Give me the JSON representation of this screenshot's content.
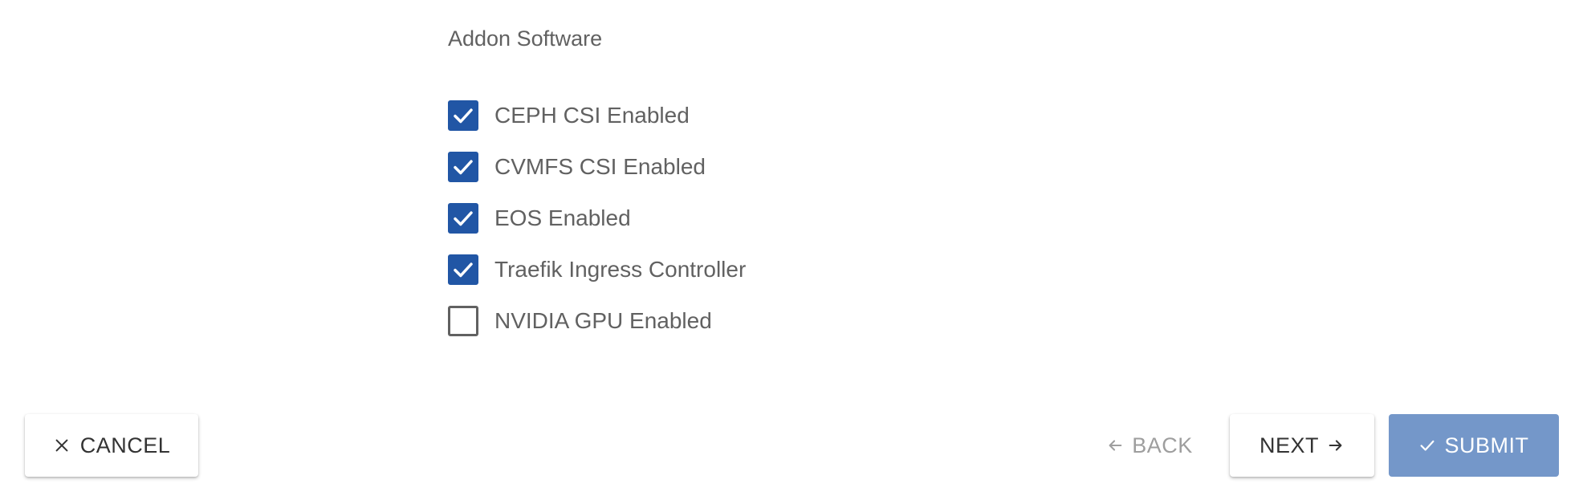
{
  "section": {
    "title": "Addon Software"
  },
  "options": [
    {
      "label": "CEPH CSI Enabled",
      "checked": true
    },
    {
      "label": "CVMFS CSI Enabled",
      "checked": true
    },
    {
      "label": "EOS Enabled",
      "checked": true
    },
    {
      "label": "Traefik Ingress Controller",
      "checked": true
    },
    {
      "label": "NVIDIA GPU Enabled",
      "checked": false
    }
  ],
  "actions": {
    "cancel_label": "CANCEL",
    "back_label": "BACK",
    "next_label": "NEXT",
    "submit_label": "SUBMIT"
  },
  "icons": {
    "cancel": "close-icon",
    "back": "arrow-left-icon",
    "next": "arrow-right-icon",
    "submit": "check-icon",
    "checkbox": "check-icon"
  },
  "colors": {
    "accent": "#2156a5",
    "submit_bg": "#7497c9",
    "text": "#616161",
    "disabled_text": "#9e9e9e"
  }
}
